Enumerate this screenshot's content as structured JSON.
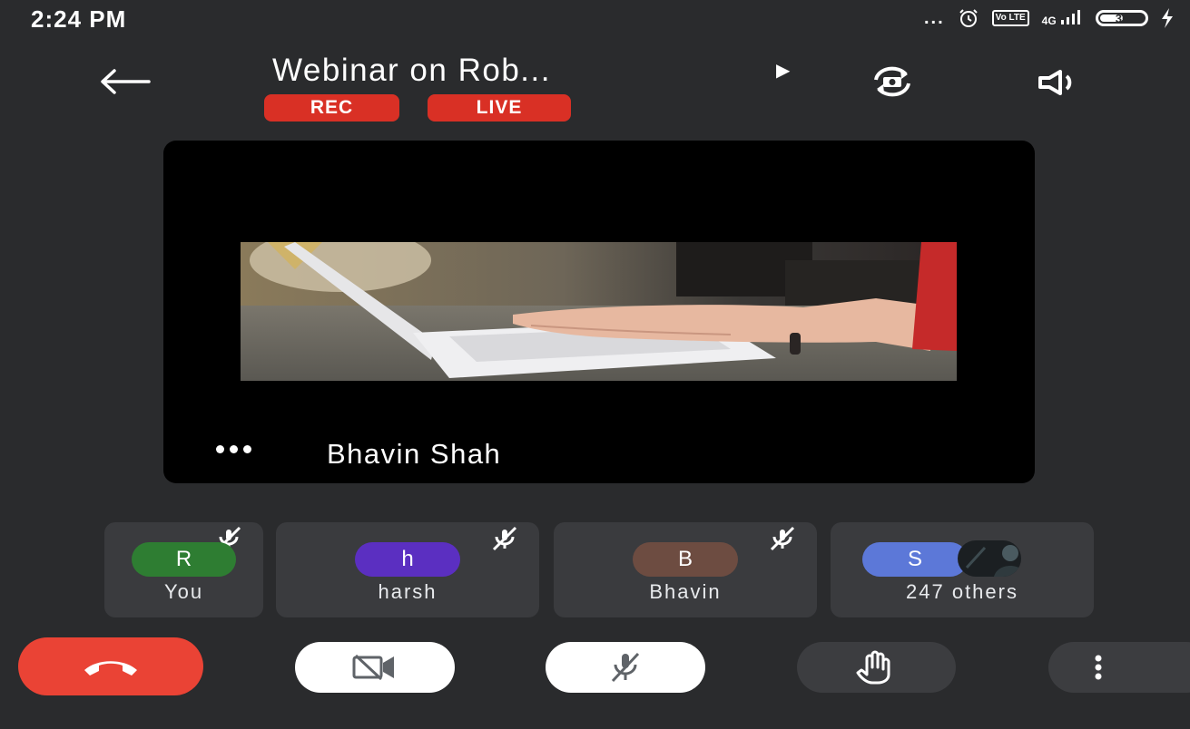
{
  "status_bar": {
    "time": "2:24 PM",
    "dots": "...",
    "lte_label": "Vo LTE",
    "network_label": "4G",
    "battery_level": "35"
  },
  "header": {
    "title": "Webinar on Rob...",
    "rec_label": "REC",
    "live_label": "LIVE"
  },
  "main_tile": {
    "speaker_name": "Bhavin Shah"
  },
  "participants": [
    {
      "initial": "R",
      "name": "You",
      "color": "#2e7d32"
    },
    {
      "initial": "h",
      "name": "harsh",
      "color": "#5b2fc1"
    },
    {
      "initial": "B",
      "name": "Bhavin",
      "color": "#6d4c41"
    },
    {
      "initial": "S",
      "name": "247 others",
      "color": "#5c78d8"
    }
  ],
  "colors": {
    "background": "#2a2b2d",
    "badge_red": "#d93025",
    "end_call_red": "#ea4335"
  },
  "icons": [
    "back-arrow-icon",
    "switch-camera-icon",
    "speaker-icon",
    "mic-off-icon",
    "end-call-icon",
    "camera-off-icon",
    "raise-hand-icon",
    "more-vertical-icon",
    "alarm-icon",
    "signal-icon",
    "battery-icon",
    "charging-icon"
  ]
}
